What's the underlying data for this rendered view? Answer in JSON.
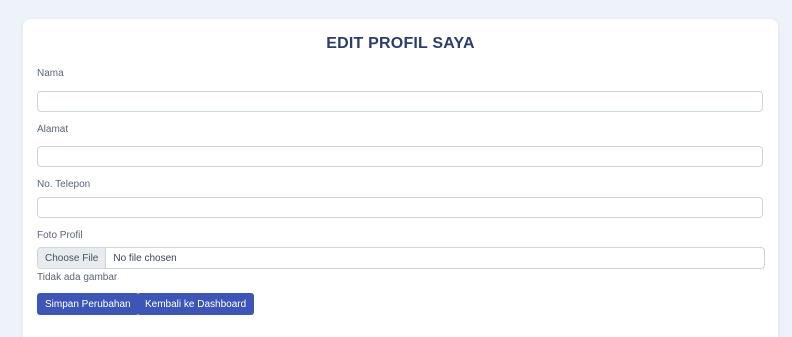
{
  "form": {
    "title": "EDIT PROFIL SAYA",
    "fields": [
      {
        "label": "Nama",
        "value": "",
        "placeholder": ""
      },
      {
        "label": "Alamat",
        "value": "",
        "placeholder": ""
      },
      {
        "label": "No. Telepon",
        "value": "",
        "placeholder": ""
      }
    ],
    "photo": {
      "label": "Foto Profil",
      "choose_button": "Choose File",
      "status": "No file chosen",
      "hint": "Tidak ada gambar"
    },
    "buttons": {
      "save": "Simpan Perubahan",
      "back": "Kembali ke Dashboard"
    }
  },
  "colors": {
    "background": "#eef2fa",
    "title": "#2b3e6b",
    "primary_button": "#3e55b8"
  }
}
